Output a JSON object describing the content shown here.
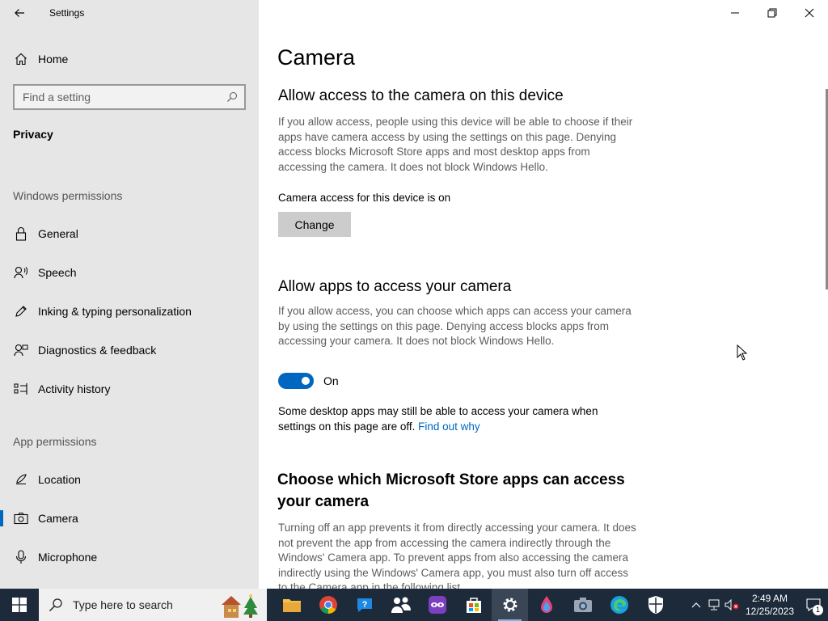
{
  "window": {
    "title": "Settings"
  },
  "sidebar": {
    "home_label": "Home",
    "search_placeholder": "Find a setting",
    "group_title": "Privacy",
    "sections": [
      {
        "label": "Windows permissions",
        "items": [
          {
            "label": "General",
            "icon": "lock-icon"
          },
          {
            "label": "Speech",
            "icon": "speech-icon"
          },
          {
            "label": "Inking & typing personalization",
            "icon": "pen-icon"
          },
          {
            "label": "Diagnostics & feedback",
            "icon": "feedback-icon"
          },
          {
            "label": "Activity history",
            "icon": "timeline-icon"
          }
        ]
      },
      {
        "label": "App permissions",
        "items": [
          {
            "label": "Location",
            "icon": "location-icon"
          },
          {
            "label": "Camera",
            "icon": "camera-icon",
            "selected": true
          },
          {
            "label": "Microphone",
            "icon": "microphone-icon"
          }
        ]
      }
    ]
  },
  "main": {
    "title": "Camera",
    "device_access": {
      "heading": "Allow access to the camera on this device",
      "description": "If you allow access, people using this device will be able to choose if their apps have camera access by using the settings on this page. Denying access blocks Microsoft Store apps and most desktop apps from accessing the camera. It does not block Windows Hello.",
      "status": "Camera access for this device is on",
      "button_label": "Change"
    },
    "app_access": {
      "heading": "Allow apps to access your camera",
      "description": "If you allow access, you can choose which apps can access your camera by using the settings on this page. Denying access blocks apps from accessing your camera. It does not block Windows Hello.",
      "toggle_state": "On",
      "toggle_on": true,
      "note": "Some desktop apps may still be able to access your camera when settings on this page are off.",
      "note_link": "Find out why"
    },
    "store_apps": {
      "heading": "Choose which Microsoft Store apps can access your camera",
      "description": "Turning off an app prevents it from directly accessing your camera. It does not prevent the app from accessing the camera indirectly through the Windows' Camera app. To prevent apps from also accessing the camera indirectly using the Windows' Camera app, you must also turn off access to the Camera app in the following list."
    }
  },
  "taskbar": {
    "search_placeholder": "Type here to search",
    "apps": [
      "file-explorer-icon",
      "chrome-icon",
      "help-icon",
      "people-icon",
      "mask-app-icon",
      "store-icon",
      "settings-icon",
      "paint-icon",
      "camera-app-icon",
      "edge-icon",
      "security-icon"
    ],
    "active_app": "settings-icon",
    "clock_time": "2:49 AM",
    "clock_date": "12/25/2023",
    "notification_count": "1"
  },
  "colors": {
    "accent": "#0067c0",
    "sidebar_bg": "#e6e6e6",
    "taskbar_bg": "#1c2a3a"
  }
}
